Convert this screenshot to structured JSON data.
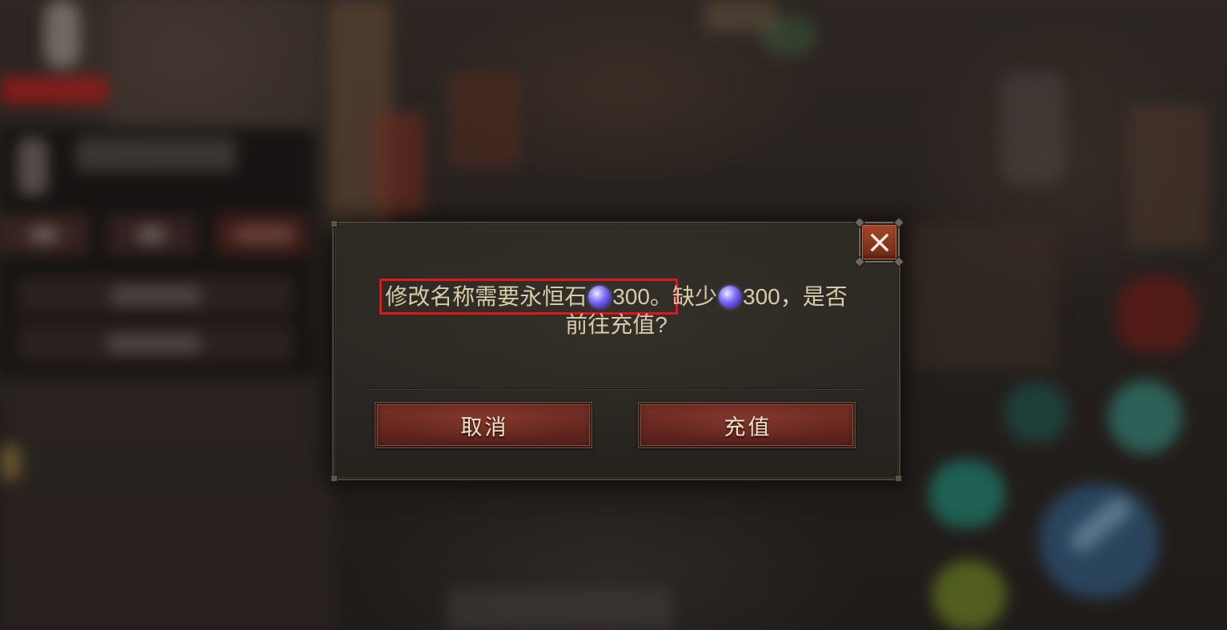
{
  "dialog": {
    "message": {
      "line1": {
        "cost_prefix": "修改名称需要永恒石",
        "cost_amount": "300。",
        "shortage_prefix": "缺少",
        "shortage_amount": "300，是否"
      },
      "line2": "前往充值?"
    },
    "currency_icon": "eternal-orb-icon",
    "close_icon": "close-icon",
    "buttons": {
      "cancel": "取消",
      "recharge": "充值"
    }
  },
  "colors": {
    "message_text": "#d9caa9",
    "highlight_box": "#e0161e",
    "button_fill": "#7a3128",
    "button_text": "#efe2cd",
    "close_button_fill": "#8a3a22",
    "dialog_background": "#2b2823"
  }
}
